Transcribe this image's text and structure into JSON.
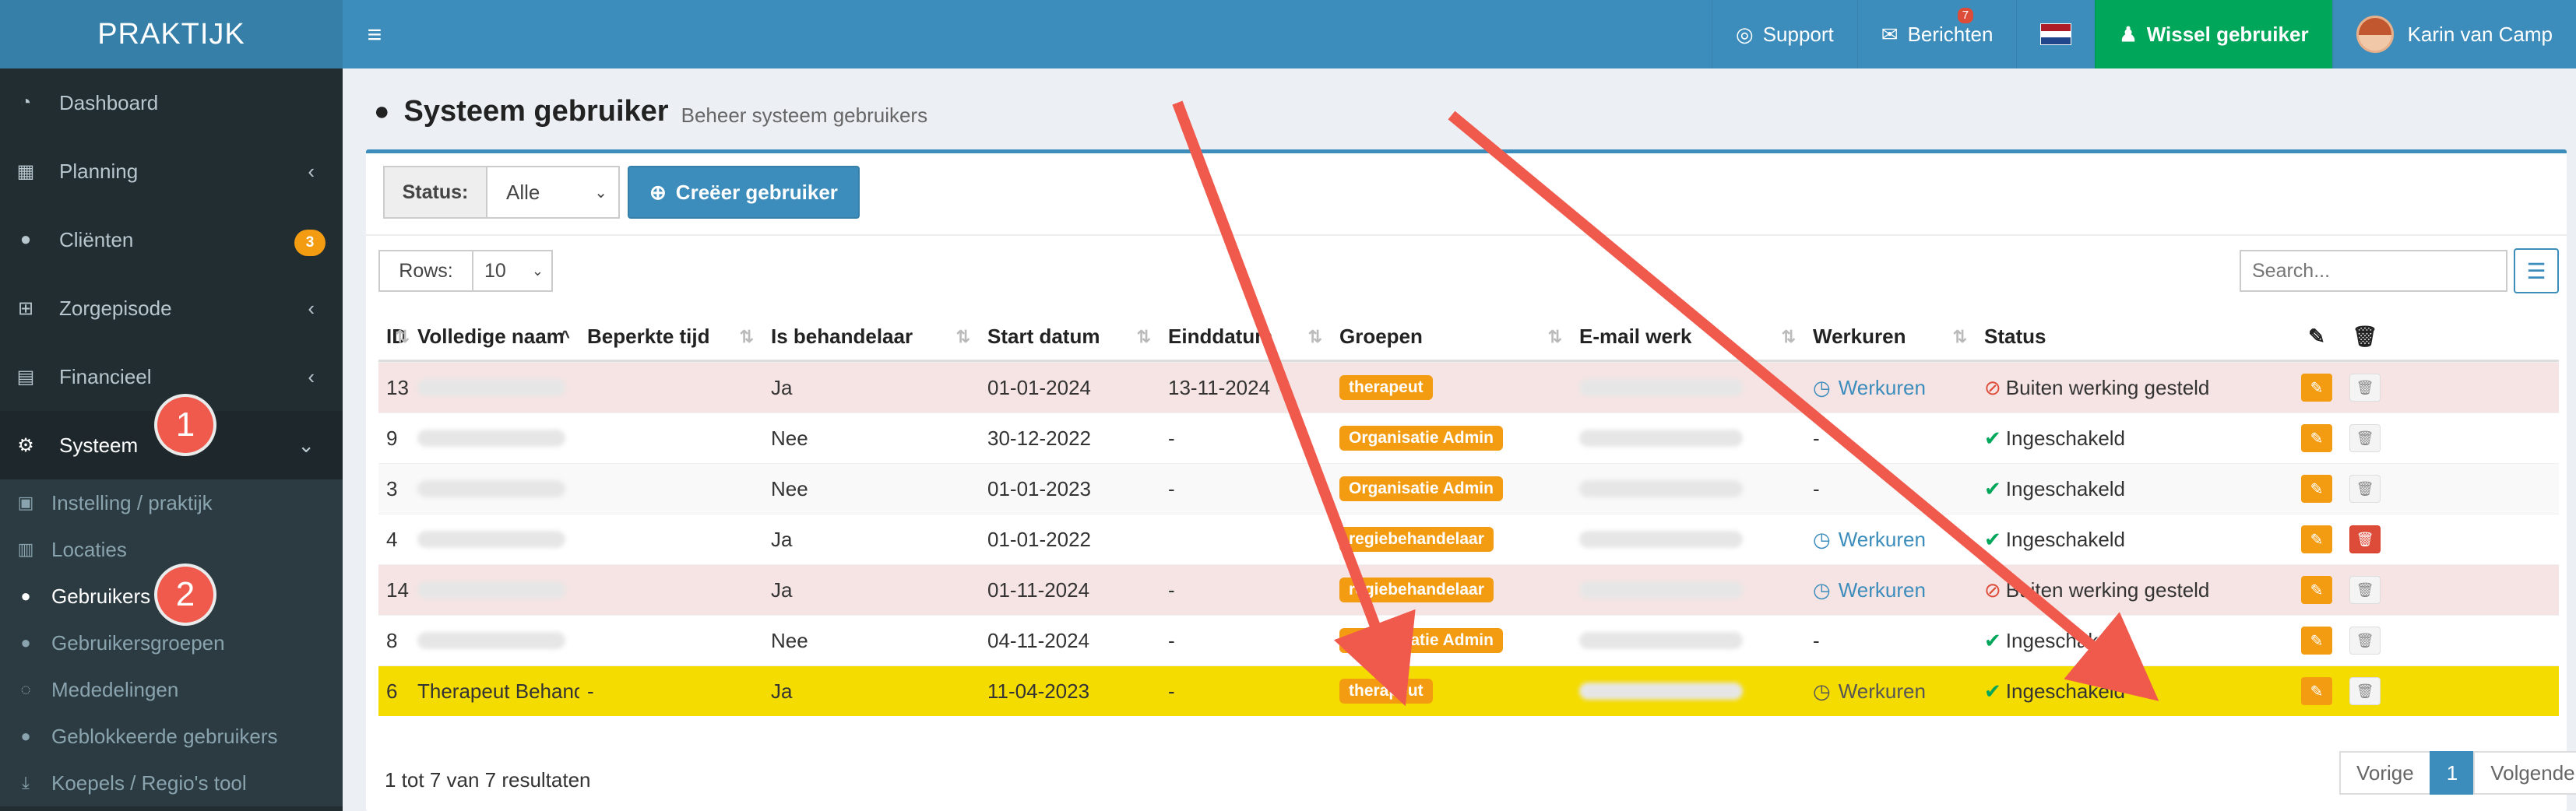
{
  "brand": "PRAKTIJK",
  "sidebar": {
    "items": [
      {
        "label": "Dashboard",
        "icon": "dashboard-icon"
      },
      {
        "label": "Planning",
        "icon": "calendar-icon"
      },
      {
        "label": "Cliënten",
        "icon": "user-icon",
        "badge": "3"
      },
      {
        "label": "Zorgepisode",
        "icon": "medkit-icon"
      },
      {
        "label": "Financieel",
        "icon": "book-icon"
      },
      {
        "label": "Systeem",
        "icon": "cogs-icon"
      }
    ],
    "submenu": [
      {
        "label": "Instelling / praktijk",
        "icon": "clipboard-icon"
      },
      {
        "label": "Locaties",
        "icon": "map-icon"
      },
      {
        "label": "Gebruikers",
        "icon": "user-icon"
      },
      {
        "label": "Gebruikersgroepen",
        "icon": "users-icon"
      },
      {
        "label": "Mededelingen",
        "icon": "comments-icon"
      },
      {
        "label": "Geblokkeerde gebruikers",
        "icon": "user-lock-icon"
      },
      {
        "label": "Koepels / Regio's tool",
        "icon": "download-icon"
      }
    ],
    "markers": [
      "1",
      "2"
    ]
  },
  "header": {
    "support": "Support",
    "messages": "Berichten",
    "messages_count": "7",
    "switch_user": "Wissel gebruiker",
    "user_name": "Karin van Camp",
    "accent": "#3c8dbc"
  },
  "page": {
    "title": "Systeem gebruiker",
    "subtitle": "Beheer systeem gebruikers"
  },
  "filters": {
    "status_label": "Status:",
    "status_value": "Alle",
    "create_button": "Creëer gebruiker",
    "rows_label": "Rows:",
    "rows_value": "10",
    "search_placeholder": "Search..."
  },
  "table": {
    "columns": [
      "ID",
      "Volledige naam",
      "Beperkte tijd",
      "Is behandelaar",
      "Start datum",
      "Einddatum",
      "Groepen",
      "E-mail werk",
      "Werkuren",
      "Status"
    ],
    "rows": [
      {
        "id": "13",
        "name": "",
        "limited": "",
        "therapist": "Ja",
        "start": "01-01-2024",
        "end": "13-11-2024",
        "group": "therapeut",
        "email": "",
        "hours": "Werkuren",
        "status": "Buiten werking gesteld"
      },
      {
        "id": "9",
        "name": "",
        "limited": "",
        "therapist": "Nee",
        "start": "30-12-2022",
        "end": "-",
        "group": "Organisatie Admin",
        "email": "",
        "hours": "-",
        "status": "Ingeschakeld"
      },
      {
        "id": "3",
        "name": "",
        "limited": "",
        "therapist": "Nee",
        "start": "01-01-2023",
        "end": "-",
        "group": "Organisatie Admin",
        "email": "",
        "hours": "-",
        "status": "Ingeschakeld"
      },
      {
        "id": "4",
        "name": "",
        "limited": "",
        "therapist": "Ja",
        "start": "01-01-2022",
        "end": "",
        "group": "regiebehandelaar",
        "email": "",
        "hours": "Werkuren",
        "status": "Ingeschakeld"
      },
      {
        "id": "14",
        "name": "",
        "limited": "",
        "therapist": "Ja",
        "start": "01-11-2024",
        "end": "-",
        "group": "regiebehandelaar",
        "email": "",
        "hours": "Werkuren",
        "status": "Buiten werking gesteld"
      },
      {
        "id": "8",
        "name": "",
        "limited": "",
        "therapist": "Nee",
        "start": "04-11-2024",
        "end": "-",
        "group": "Organisatie Admin",
        "email": "",
        "hours": "-",
        "status": "Ingeschakeld"
      },
      {
        "id": "6",
        "name": "Therapeut Behandelaar",
        "limited": "-",
        "therapist": "Ja",
        "start": "11-04-2023",
        "end": "-",
        "group": "therapeut",
        "email": "",
        "hours": "Werkuren",
        "status": "Ingeschakeld"
      }
    ]
  },
  "footer": {
    "info": "1 tot 7 van 7 resultaten",
    "prev": "Vorige",
    "page": "1",
    "next": "Volgende"
  }
}
